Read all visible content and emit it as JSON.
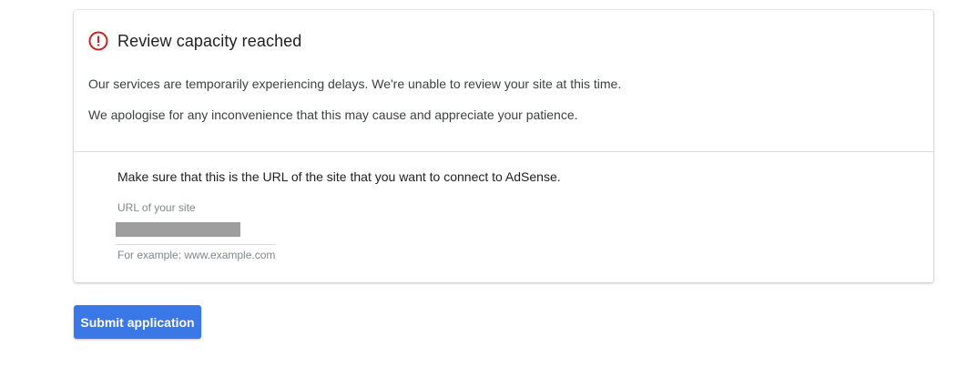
{
  "card": {
    "title": "Review capacity reached",
    "alert_icon": "alert-circle-icon",
    "alert_color": "#c5221f",
    "messages": [
      "Our services are temporarily experiencing delays. We're unable to review your site at this time.",
      "We apologise for any inconvenience that this may cause and appreciate your patience."
    ],
    "instruction": "Make sure that this is the URL of the site that you want to connect to AdSense.",
    "url_field": {
      "label": "URL of your site",
      "value_redacted": true,
      "helper": "For example: www.example.com"
    }
  },
  "actions": {
    "submit_label": "Submit application",
    "submit_color": "#3b78e7"
  }
}
